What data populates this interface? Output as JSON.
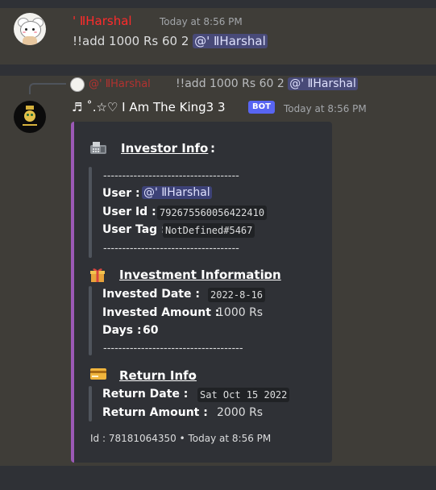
{
  "message1": {
    "author": "' ⅡHarshal",
    "timestamp": "Today at 8:56 PM",
    "content_prefix": "!!add 1000 Rs 60 2",
    "mention": "@' ⅡHarshal"
  },
  "reply": {
    "author": "@' ⅡHarshal",
    "content_prefix": "!!add 1000 Rs 60 2",
    "mention": "@' ⅡHarshal"
  },
  "message2": {
    "author": "♬ ˚.☆♡ I Am The King3 3",
    "bot_tag": "BOT",
    "timestamp": "Today at 8:56 PM"
  },
  "embed": {
    "color": "#9b59b6",
    "investor": {
      "title": "Investor Info",
      "colon": ":",
      "dashes_top": "------------------------------------",
      "user_label": "User :",
      "user_value": "@' ⅡHarshal",
      "userid_label": "User Id :",
      "userid_value": "792675560056422410",
      "usertag_label": "User Tag :",
      "usertag_value": "NotDefined#5467",
      "dashes_bottom": "------------------------------------"
    },
    "investment": {
      "title": "Investment Information",
      "colon": ":",
      "date_label": "Invested Date :",
      "date_value": "2022-8-16",
      "amount_label": "Invested Amount :",
      "amount_value": "1000 Rs",
      "days_label": "Days :",
      "days_value": "60",
      "dashes": "-------------------------------------"
    },
    "return": {
      "title": "Return Info",
      "colon": ":",
      "date_label": "Return Date :",
      "date_value": "Sat Oct 15 2022",
      "amount_label": "Return Amount :",
      "amount_value": "2000 Rs"
    },
    "footer": "Id : 78181064350 • Today at 8:56 PM"
  },
  "icons": {
    "section1": "fax-icon",
    "section2": "gift-icon",
    "section3": "credit-card-icon"
  }
}
